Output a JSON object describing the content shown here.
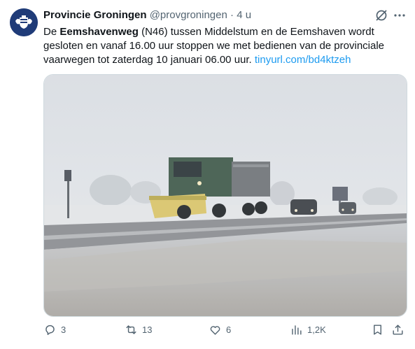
{
  "tweet": {
    "display_name": "Provincie Groningen",
    "handle": "@provgroningen",
    "separator": "·",
    "time": "4 u",
    "text": {
      "t1": "De ",
      "bold": "Eemshavenweg",
      "t2": " (N46) tussen Middelstum en de Eemshaven wordt gesloten en vanaf 16.00 uur stoppen we met bedienen van de provinciale vaarwegen tot zaterdag 10 januari 06.00 uur. ",
      "link": "tinyurl.com/bd4ktzeh"
    }
  },
  "actions": {
    "replies": "3",
    "reposts": "13",
    "likes": "6",
    "views": "1,2K"
  },
  "icons": {
    "avatar": "province-crest-icon",
    "grok": "grok-icon",
    "more": "more-icon",
    "reply": "reply-icon",
    "repost": "repost-icon",
    "like": "heart-icon",
    "views": "views-icon",
    "bookmark": "bookmark-icon",
    "share": "share-icon"
  },
  "colors": {
    "link": "#1d9bf0",
    "muted": "#536471",
    "avatar_bg": "#1f3b78"
  }
}
